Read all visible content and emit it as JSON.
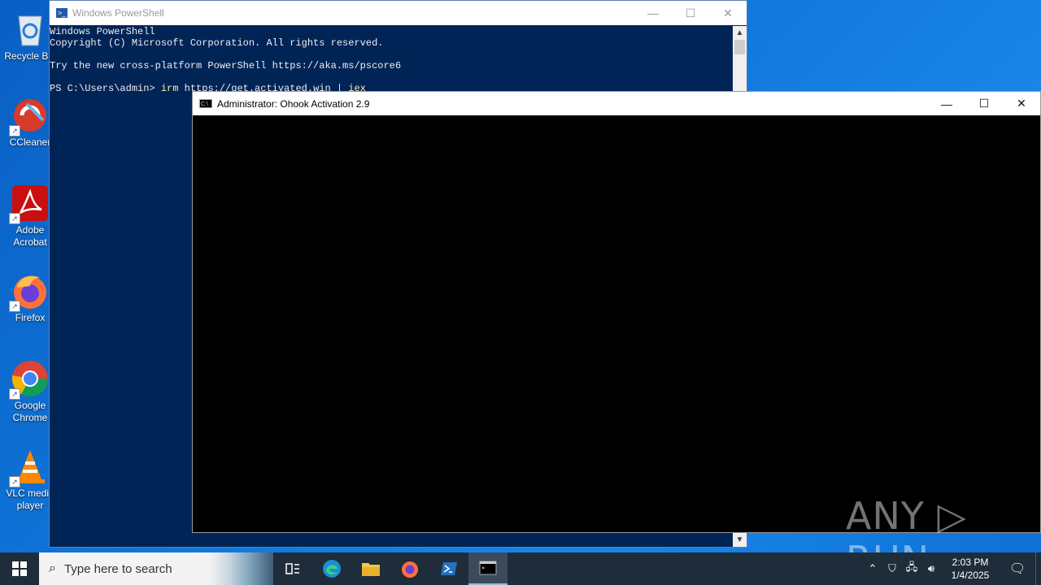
{
  "desktop": {
    "icons": [
      {
        "label": "Recycle Bin",
        "icon": "recycle-bin-icon"
      },
      {
        "label": "CCleaner",
        "icon": "ccleaner-icon"
      },
      {
        "label": "Adobe Acrobat",
        "icon": "adobe-acrobat-icon"
      },
      {
        "label": "Firefox",
        "icon": "firefox-icon"
      },
      {
        "label": "Google Chrome",
        "icon": "google-chrome-icon"
      },
      {
        "label": "VLC media player",
        "icon": "vlc-icon"
      }
    ]
  },
  "powershell": {
    "title": "Windows PowerShell",
    "lines": [
      "Windows PowerShell",
      "Copyright (C) Microsoft Corporation. All rights reserved.",
      "",
      "Try the new cross-platform PowerShell https://aka.ms/pscore6",
      ""
    ],
    "prompt": "PS C:\\Users\\admin> ",
    "command_keyword": "irm",
    "command_arg": " https://get.activated.win | ",
    "command_tail": "iex"
  },
  "cmd": {
    "title": "Administrator:  Ohook Activation 2.9"
  },
  "watermark": "ANY ▷ RUN",
  "taskbar": {
    "search_placeholder": "Type here to search",
    "time": "2:03 PM",
    "date": "1/4/2025"
  },
  "colors": {
    "powershell_bg": "#012456",
    "desktop_bg": "#0f74d8",
    "taskbar_bg": "#1f2c3a",
    "prompt_yellow": "#f9f1a5"
  }
}
